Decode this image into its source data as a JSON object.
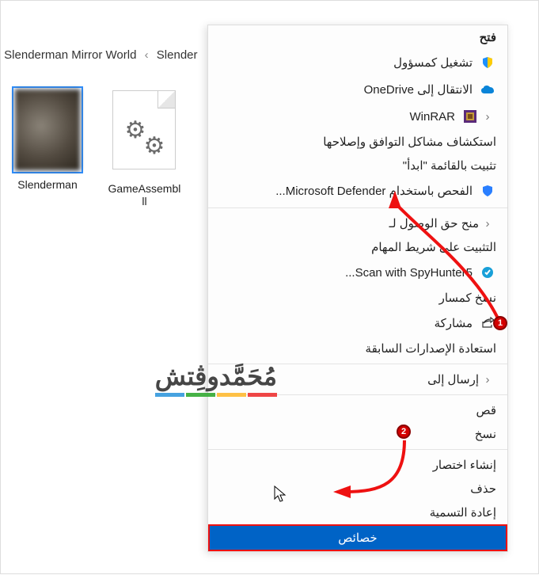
{
  "breadcrumb": {
    "sep": "‹",
    "parts": [
      "Slenderman Mirror World",
      "Slender"
    ]
  },
  "files": [
    {
      "label": "Slenderman",
      "selected": true,
      "kind": "thumb"
    },
    {
      "label": "GameAssembl",
      "label2": "ll",
      "kind": "paper"
    }
  ],
  "menu": {
    "open": "فتح",
    "run_admin": "تشغيل كمسؤول",
    "onedrive": "الانتقال إلى OneDrive",
    "winrar": "WinRAR",
    "compat": "استكشاف مشاكل التوافق وإصلاحها",
    "pin_start": "تثبيت بالقائمة \"ابدأ\"",
    "defender": "الفحص باستخدام Microsoft Defender...",
    "grant_access": "منح حق الوصول لـ",
    "pin_taskbar": "التثبيت على شريط المهام",
    "spyhunter": "Scan with SpyHunter5...",
    "copy_path": "نسخ كمسار",
    "share": "مشاركة",
    "restore": "استعادة الإصدارات السابقة",
    "send_to": "إرسال إلى",
    "cut": "قص",
    "copy": "نسخ",
    "shortcut": "إنشاء اختصار",
    "delete": "حذف",
    "rename": "إعادة التسمية",
    "properties": "خصائص"
  },
  "badges": {
    "b1": "1",
    "b2": "2"
  },
  "watermark": "مُحَمَّدوڤِتش"
}
